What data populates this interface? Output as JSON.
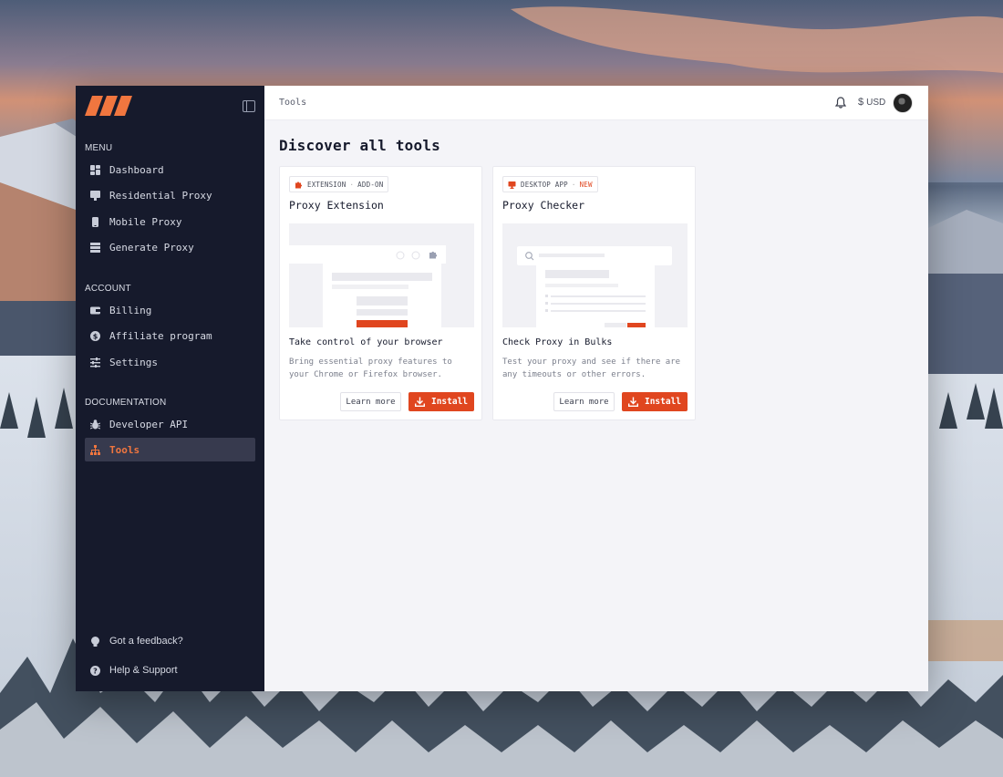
{
  "colors": {
    "sidebar_bg": "#161a2c",
    "accent": "#e0461f",
    "active_text": "#f0763f",
    "main_bg": "#f4f4f8"
  },
  "sidebar": {
    "collapse_icon": "sidebar-toggle-icon",
    "sections": [
      {
        "label": "MENU",
        "items": [
          {
            "label": "Dashboard",
            "icon": "dashboard-icon"
          },
          {
            "label": "Residential Proxy",
            "icon": "monitor-icon"
          },
          {
            "label": "Mobile Proxy",
            "icon": "mobile-icon"
          },
          {
            "label": "Generate Proxy",
            "icon": "server-icon"
          }
        ]
      },
      {
        "label": "ACCOUNT",
        "items": [
          {
            "label": "Billing",
            "icon": "wallet-icon"
          },
          {
            "label": "Affiliate program",
            "icon": "dollar-circle-icon"
          },
          {
            "label": "Settings",
            "icon": "sliders-icon"
          }
        ]
      },
      {
        "label": "DOCUMENTATION",
        "items": [
          {
            "label": "Developer API",
            "icon": "bug-icon"
          },
          {
            "label": "Tools",
            "icon": "sitemap-icon",
            "active": true
          }
        ]
      }
    ],
    "footer": [
      {
        "label": "Got a feedback?",
        "icon": "lightbulb-icon"
      },
      {
        "label": "Help & Support",
        "icon": "question-circle-icon"
      }
    ]
  },
  "topbar": {
    "breadcrumb": "Tools",
    "currency": "USD",
    "bell_icon": "bell-icon",
    "currency_icon": "dollar-icon"
  },
  "main": {
    "title": "Discover all tools",
    "cards": [
      {
        "tag_icon": "puzzle-icon",
        "tag_primary": "EXTENSION",
        "tag_secondary": "ADD-ON",
        "title": "Proxy Extension",
        "subtitle": "Take control of your browser",
        "description": "Bring essential proxy features to your Chrome or Firefox browser.",
        "learn_more": "Learn more",
        "install": "Install"
      },
      {
        "tag_icon": "desktop-icon",
        "tag_primary": "DESKTOP APP",
        "tag_secondary": "NEW",
        "title": "Proxy Checker",
        "subtitle": "Check Proxy in Bulks",
        "description": "Test your proxy and see if there are any timeouts or other errors.",
        "learn_more": "Learn more",
        "install": "Install"
      }
    ]
  }
}
